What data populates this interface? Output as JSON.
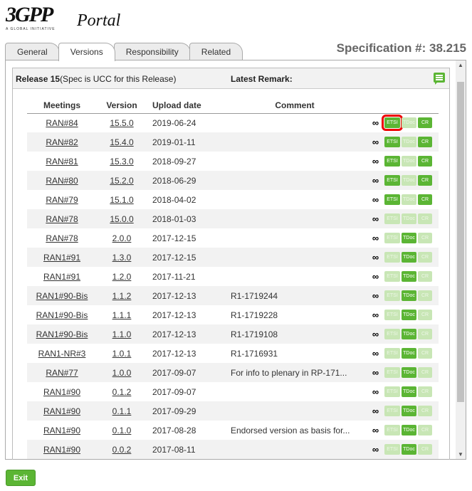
{
  "logo": {
    "main": "3GPP",
    "tagline": "A GLOBAL INITIATIVE"
  },
  "portal_title": "Portal",
  "tabs": [
    {
      "label": "General"
    },
    {
      "label": "Versions",
      "active": true
    },
    {
      "label": "Responsibility"
    },
    {
      "label": "Related"
    }
  ],
  "spec": {
    "label": "Specification #: 38.215"
  },
  "release": {
    "title": "Release 15",
    "note": "(Spec is UCC for this Release)",
    "remark_label": "Latest Remark:"
  },
  "table": {
    "headers": {
      "meetings": "Meetings",
      "version": "Version",
      "upload_date": "Upload date",
      "comment": "Comment"
    },
    "button_labels": {
      "etsi": "ETSI",
      "tdoc": "TDoc",
      "cr": "CR"
    },
    "rows": [
      {
        "meeting": "RAN#84",
        "version": "15.5.0",
        "date": "2019-06-24",
        "comment": "",
        "etsi": true,
        "tdoc": false,
        "cr": true
      },
      {
        "meeting": "RAN#82",
        "version": "15.4.0",
        "date": "2019-01-11",
        "comment": "",
        "etsi": true,
        "tdoc": false,
        "cr": true
      },
      {
        "meeting": "RAN#81",
        "version": "15.3.0",
        "date": "2018-09-27",
        "comment": "",
        "etsi": true,
        "tdoc": false,
        "cr": true
      },
      {
        "meeting": "RAN#80",
        "version": "15.2.0",
        "date": "2018-06-29",
        "comment": "",
        "etsi": true,
        "tdoc": false,
        "cr": true
      },
      {
        "meeting": "RAN#79",
        "version": "15.1.0",
        "date": "2018-04-02",
        "comment": "",
        "etsi": true,
        "tdoc": false,
        "cr": true
      },
      {
        "meeting": "RAN#78",
        "version": "15.0.0",
        "date": "2018-01-03",
        "comment": "",
        "etsi": false,
        "tdoc": false,
        "cr": false
      },
      {
        "meeting": "RAN#78",
        "version": "2.0.0",
        "date": "2017-12-15",
        "comment": "",
        "etsi": false,
        "tdoc": true,
        "cr": false
      },
      {
        "meeting": "RAN1#91",
        "version": "1.3.0",
        "date": "2017-12-15",
        "comment": "",
        "etsi": false,
        "tdoc": true,
        "cr": false
      },
      {
        "meeting": "RAN1#91",
        "version": "1.2.0",
        "date": "2017-11-21",
        "comment": "",
        "etsi": false,
        "tdoc": true,
        "cr": false
      },
      {
        "meeting": "RAN1#90-Bis",
        "version": "1.1.2",
        "date": "2017-12-13",
        "comment": "R1-1719244",
        "etsi": false,
        "tdoc": true,
        "cr": false
      },
      {
        "meeting": "RAN1#90-Bis",
        "version": "1.1.1",
        "date": "2017-12-13",
        "comment": "R1-1719228",
        "etsi": false,
        "tdoc": true,
        "cr": false
      },
      {
        "meeting": "RAN1#90-Bis",
        "version": "1.1.0",
        "date": "2017-12-13",
        "comment": "R1-1719108",
        "etsi": false,
        "tdoc": true,
        "cr": false
      },
      {
        "meeting": "RAN1-NR#3",
        "version": "1.0.1",
        "date": "2017-12-13",
        "comment": "R1-1716931",
        "etsi": false,
        "tdoc": true,
        "cr": false
      },
      {
        "meeting": "RAN#77",
        "version": "1.0.0",
        "date": "2017-09-07",
        "comment": "For info to plenary in RP-171...",
        "etsi": false,
        "tdoc": true,
        "cr": false
      },
      {
        "meeting": "RAN1#90",
        "version": "0.1.2",
        "date": "2017-09-07",
        "comment": "",
        "etsi": false,
        "tdoc": true,
        "cr": false
      },
      {
        "meeting": "RAN1#90",
        "version": "0.1.1",
        "date": "2017-09-29",
        "comment": "",
        "etsi": false,
        "tdoc": true,
        "cr": false
      },
      {
        "meeting": "RAN1#90",
        "version": "0.1.0",
        "date": "2017-08-28",
        "comment": "Endorsed version as basis for...",
        "etsi": false,
        "tdoc": true,
        "cr": false
      },
      {
        "meeting": "RAN1#90",
        "version": "0.0.2",
        "date": "2017-08-11",
        "comment": "",
        "etsi": false,
        "tdoc": true,
        "cr": false
      }
    ]
  },
  "exit_label": "Exit",
  "colors": {
    "accent": "#5bb534",
    "disabled": "#c8e6b5",
    "highlight": "#e00000"
  }
}
